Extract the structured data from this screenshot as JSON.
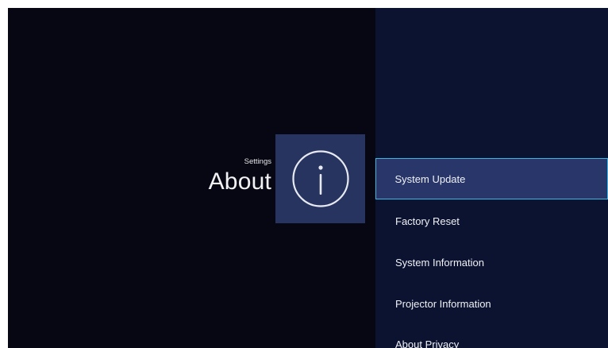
{
  "header": {
    "breadcrumb": "Settings",
    "title": "About"
  },
  "icon": {
    "name": "info-icon",
    "tile_color": "#26345f"
  },
  "menu": {
    "selected_index": 0,
    "accent_color": "#37b9e6",
    "items": [
      {
        "label": "System Update"
      },
      {
        "label": "Factory Reset"
      },
      {
        "label": "System Information"
      },
      {
        "label": "Projector Information"
      },
      {
        "label": "About Privacy"
      }
    ]
  }
}
